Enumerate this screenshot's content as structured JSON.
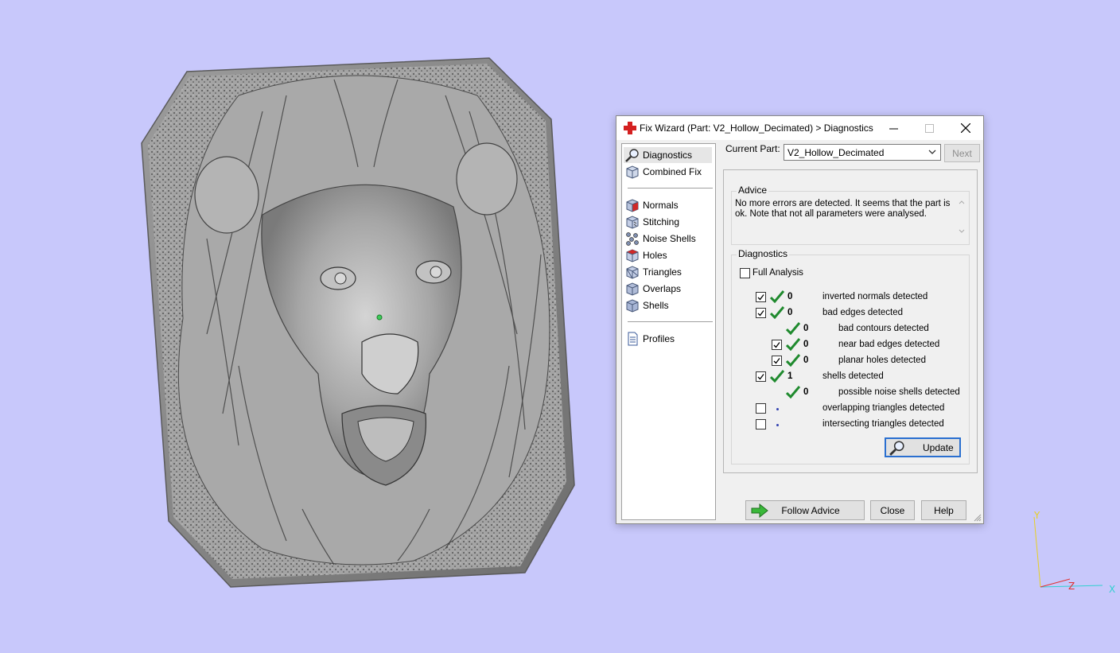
{
  "window": {
    "title": "Fix Wizard (Part: V2_Hollow_Decimated) > Diagnostics",
    "minimize_icon": "minimize-icon",
    "maximize_icon": "maximize-icon",
    "close_icon": "close-icon"
  },
  "nav": {
    "top_items": [
      {
        "label": "Diagnostics",
        "icon": "magnifier-icon",
        "selected": true
      },
      {
        "label": "Combined Fix",
        "icon": "cube-icon"
      }
    ],
    "fix_items": [
      {
        "label": "Normals",
        "icon": "normals-cube-icon"
      },
      {
        "label": "Stitching",
        "icon": "stitching-cube-icon"
      },
      {
        "label": "Noise Shells",
        "icon": "noise-shells-icon"
      },
      {
        "label": "Holes",
        "icon": "holes-cube-icon"
      },
      {
        "label": "Triangles",
        "icon": "triangles-cube-icon"
      },
      {
        "label": "Overlaps",
        "icon": "overlaps-cube-icon"
      },
      {
        "label": "Shells",
        "icon": "shells-cube-icon"
      }
    ],
    "bottom_items": [
      {
        "label": "Profiles",
        "icon": "document-icon"
      }
    ]
  },
  "current_part": {
    "label": "Current Part:",
    "value": "V2_Hollow_Decimated",
    "next_label": "Next"
  },
  "advice": {
    "title": "Advice",
    "text": "No more errors are detected. It seems that the part is ok. Note that not all parameters were analysed."
  },
  "diagnostics": {
    "title": "Diagnostics",
    "full_analysis_label": "Full Analysis",
    "full_analysis_checked": false,
    "rows": [
      {
        "checkbox": true,
        "checked": true,
        "status": "ok",
        "count": "0",
        "label": "inverted normals detected",
        "indent": 0
      },
      {
        "checkbox": true,
        "checked": true,
        "status": "ok",
        "count": "0",
        "label": "bad edges detected",
        "indent": 0
      },
      {
        "checkbox": false,
        "checked": false,
        "status": "ok",
        "count": "0",
        "label": "bad contours detected",
        "indent": 1
      },
      {
        "checkbox": true,
        "checked": true,
        "status": "ok",
        "count": "0",
        "label": "near bad edges detected",
        "indent": 1
      },
      {
        "checkbox": true,
        "checked": true,
        "status": "ok",
        "count": "0",
        "label": "planar holes detected",
        "indent": 1
      },
      {
        "checkbox": true,
        "checked": true,
        "status": "ok",
        "count": "1",
        "label": "shells detected",
        "indent": 0
      },
      {
        "checkbox": false,
        "checked": false,
        "status": "ok",
        "count": "0",
        "label": "possible noise shells detected",
        "indent": 1
      },
      {
        "checkbox": true,
        "checked": false,
        "status": "pending",
        "count": "",
        "label": "overlapping triangles detected",
        "indent": 0
      },
      {
        "checkbox": true,
        "checked": false,
        "status": "pending",
        "count": "",
        "label": "intersecting triangles detected",
        "indent": 0
      }
    ],
    "update_label": "Update"
  },
  "footer": {
    "follow_advice_label": "Follow Advice",
    "close_label": "Close",
    "help_label": "Help"
  },
  "viewport": {
    "axis_y": "Y",
    "axis_z": "Z",
    "axis_x": "X",
    "colors": {
      "background": "#c8c8fb",
      "model": "#8c8c8c",
      "check": "#1f8a2e"
    }
  }
}
